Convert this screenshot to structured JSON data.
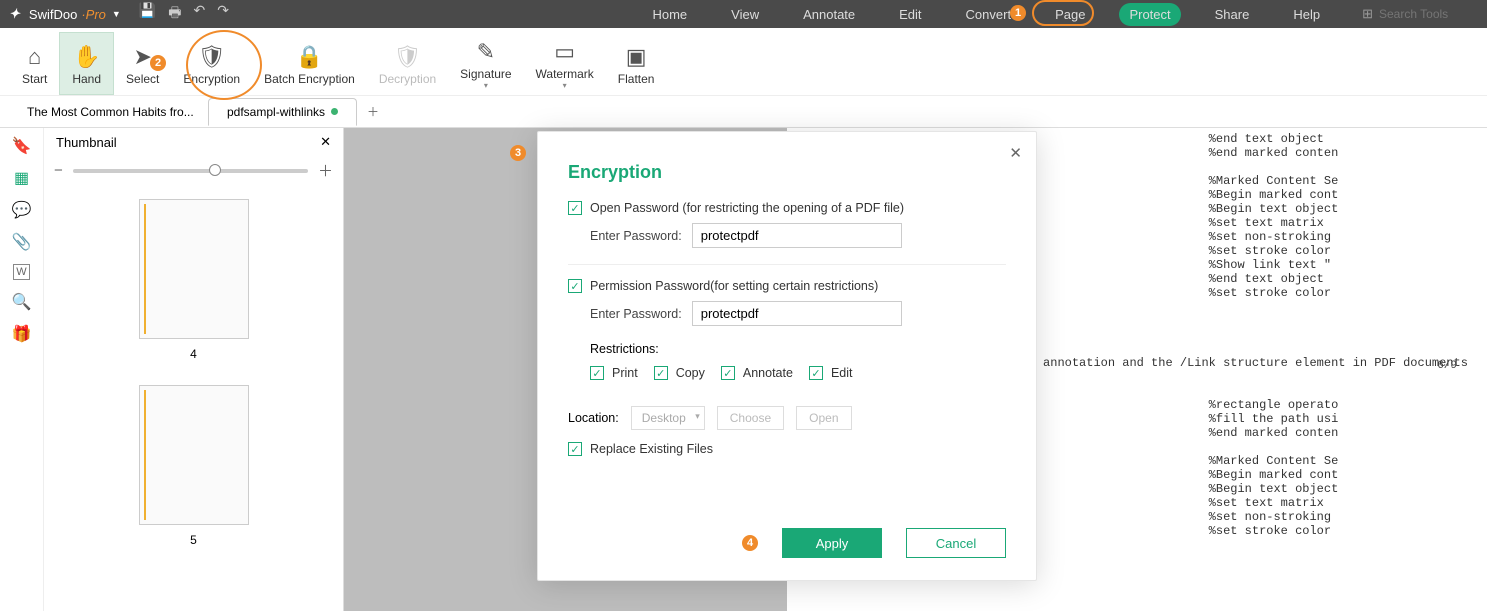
{
  "brand": {
    "name1": "SwifDoo",
    "name2": "·Pro"
  },
  "menu": {
    "items": [
      "Home",
      "View",
      "Annotate",
      "Edit",
      "Convert",
      "Page",
      "Protect",
      "Share",
      "Help"
    ],
    "active_index": 6,
    "search_placeholder": "Search Tools"
  },
  "ribbon": [
    {
      "icon": "⌂",
      "label": "Start"
    },
    {
      "icon": "✋",
      "label": "Hand",
      "selected": true
    },
    {
      "icon": "➤",
      "label": "Select"
    },
    {
      "icon": "🛡",
      "label": "Encryption"
    },
    {
      "icon": "🔒",
      "label": "Batch Encryption"
    },
    {
      "icon": "🛡",
      "label": "Decryption",
      "disabled": true
    },
    {
      "icon": "✎",
      "label": "Signature",
      "dropdown": true
    },
    {
      "icon": "▭",
      "label": "Watermark",
      "dropdown": true
    },
    {
      "icon": "▣",
      "label": "Flatten"
    }
  ],
  "tabs": [
    {
      "title": "The Most Common Habits fro..."
    },
    {
      "title": "pdfsampl-withlinks",
      "active": true,
      "dirty": true
    }
  ],
  "thumb": {
    "title": "Thumbnail",
    "pages": [
      "4",
      "5"
    ]
  },
  "pageinfo": "6/9",
  "dialog": {
    "title": "Encryption",
    "open_pw_label": "Open Password (for restricting the opening of a PDF file)",
    "perm_pw_label": "Permission Password(for setting certain restrictions)",
    "enter_pw": "Enter Password:",
    "pw1": "protectpdf",
    "pw2": "protectpdf",
    "restrictions_label": "Restrictions:",
    "restrictions": [
      "Print",
      "Copy",
      "Annotate",
      "Edit"
    ],
    "location_label": "Location:",
    "location_value": "Desktop",
    "choose": "Choose",
    "open": "Open",
    "replace": "Replace Existing Files",
    "apply": "Apply",
    "cancel": "Cancel"
  },
  "canvas_text": "                                                          %end text object\n                                                          %end marked conten\n\n                                                          %Marked Content Se\n                                                          %Begin marked cont\n                                                          %Begin text object\n                         4 Tm                             %set text matrix\n                                                          %set non-stroking\n                                                          %set stroke color\n                         4(k)] TJ                         %Show link text \"\n                                                          %end text object\n                                                          %set stroke color\n\n\n\n\n   ks and link text using the Link annotation and the /Link structure element in PDF documents\n\n\n                         0.72 re                          %rectangle operato\n                                                          %fill the path usi\n                                                          %end marked conten\n\n                                                          %Marked Content Se\n                                                          %Begin marked cont\n                                                          %Begin text object\n                         4 Tm                             %set text matrix\n                            0 g                           %set non-stroking\n                            0 G                           %set stroke color"
}
